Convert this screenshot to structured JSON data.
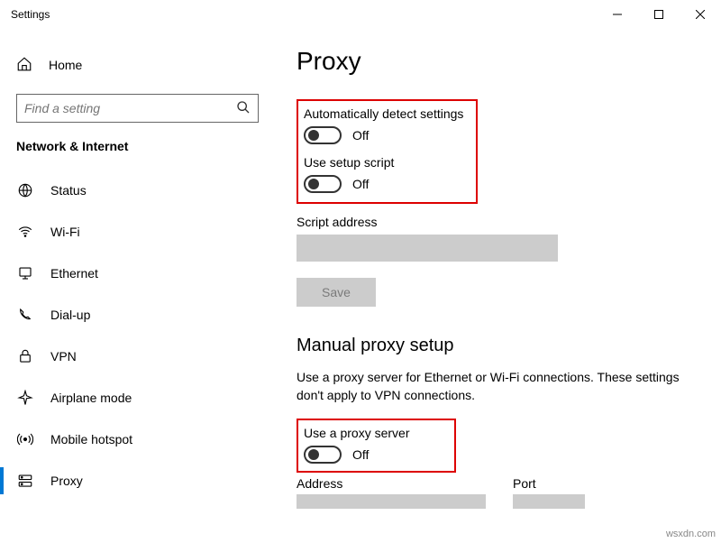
{
  "window_title": "Settings",
  "sidebar": {
    "home": "Home",
    "search_placeholder": "Find a setting",
    "category": "Network & Internet",
    "items": [
      {
        "label": "Status"
      },
      {
        "label": "Wi-Fi"
      },
      {
        "label": "Ethernet"
      },
      {
        "label": "Dial-up"
      },
      {
        "label": "VPN"
      },
      {
        "label": "Airplane mode"
      },
      {
        "label": "Mobile hotspot"
      },
      {
        "label": "Proxy"
      }
    ]
  },
  "page": {
    "title": "Proxy",
    "auto_detect_label": "Automatically detect settings",
    "auto_detect_state": "Off",
    "setup_script_label": "Use setup script",
    "setup_script_state": "Off",
    "script_address_label": "Script address",
    "save_label": "Save",
    "manual_title": "Manual proxy setup",
    "manual_desc": "Use a proxy server for Ethernet or Wi-Fi connections. These settings don't apply to VPN connections.",
    "use_proxy_label": "Use a proxy server",
    "use_proxy_state": "Off",
    "address_label": "Address",
    "port_label": "Port"
  },
  "watermark": "wsxdn.com"
}
